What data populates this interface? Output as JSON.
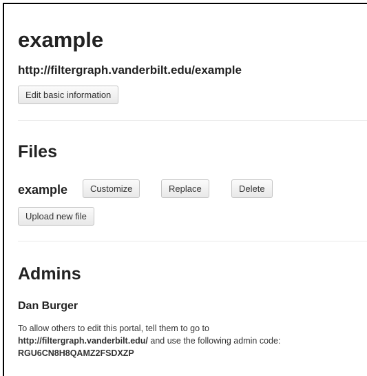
{
  "portal": {
    "title": "example",
    "url": "http://filtergraph.vanderbilt.edu/example",
    "edit_button_label": "Edit basic information"
  },
  "files": {
    "heading": "Files",
    "items": [
      {
        "name": "example",
        "customize_label": "Customize",
        "replace_label": "Replace",
        "delete_label": "Delete"
      }
    ],
    "upload_button_label": "Upload new file"
  },
  "admins": {
    "heading": "Admins",
    "names": [
      "Dan Burger"
    ],
    "note_intro": "To allow others to edit this portal, tell them to go to",
    "note_link": "http://filtergraph.vanderbilt.edu/",
    "note_middle": " and use the following admin code:",
    "admin_code": "RGU6CN8H8QAMZ2FSDXZP"
  },
  "colors": {
    "text": "#222222",
    "button_border": "#c4c4c4",
    "divider": "#e9e9e9",
    "frame": "#000000"
  }
}
